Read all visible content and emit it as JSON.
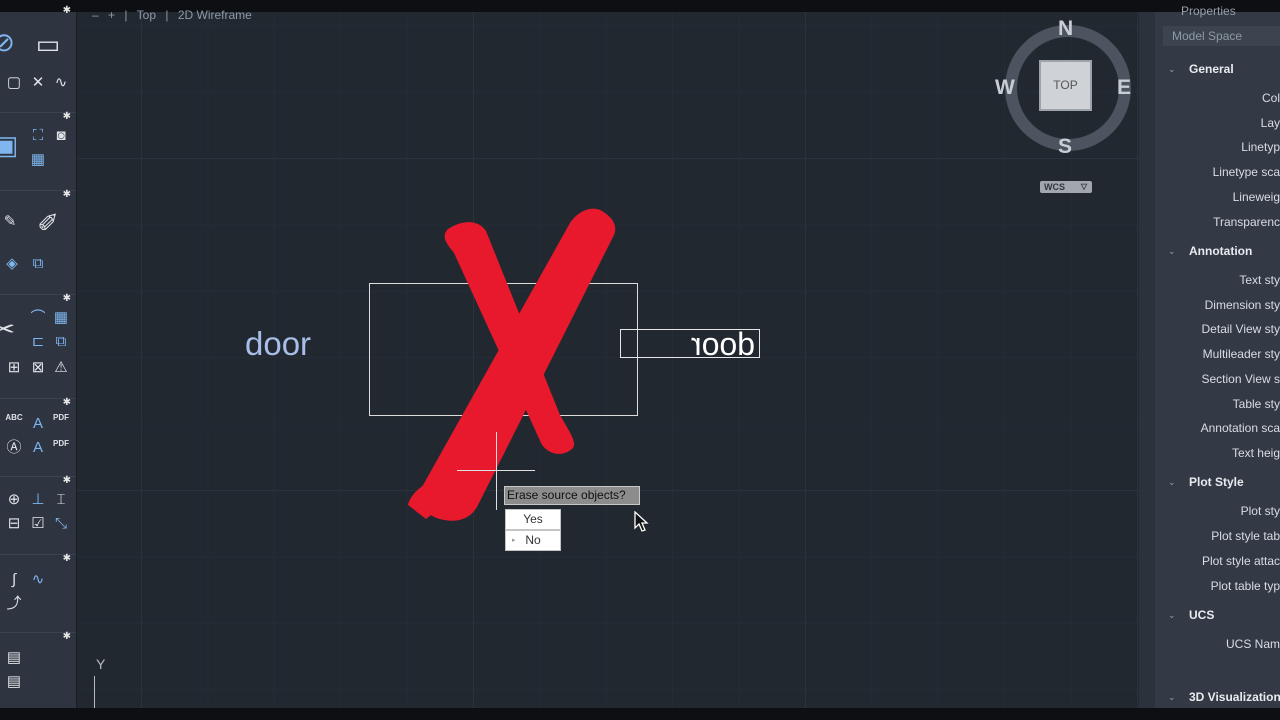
{
  "viewport": {
    "minus": "–",
    "plus": "+",
    "view": "Top",
    "visual_style": "2D Wireframe"
  },
  "drawing": {
    "label": "door",
    "mirror_label": "door"
  },
  "prompt": {
    "question": "Erase source objects?",
    "yes": "Yes",
    "no": "No"
  },
  "viewcube": {
    "n": "N",
    "s": "S",
    "e": "E",
    "w": "W",
    "face": "TOP",
    "wcs": "WCS"
  },
  "ucs": {
    "y": "Y"
  },
  "properties": {
    "title": "Properties",
    "selector": "Model Space",
    "general": {
      "title": "General",
      "items": [
        "Col",
        "Lay",
        "Linetyp",
        "Linetype sca",
        "Lineweig",
        "Transparenc"
      ]
    },
    "annotation": {
      "title": "Annotation",
      "items": [
        "Text sty",
        "Dimension sty",
        "Detail View sty",
        "Multileader sty",
        "Section View s",
        "Table sty",
        "Annotation sca",
        "Text heig"
      ]
    },
    "plot_style": {
      "title": "Plot Style",
      "items": [
        "Plot sty",
        "Plot style tab",
        "Plot style attac",
        "Plot table typ"
      ]
    },
    "ucs": {
      "title": "UCS",
      "items": [
        "UCS Nam"
      ]
    },
    "viz": {
      "title": "3D Visualization"
    }
  },
  "toolbar": {
    "abc": "ABC",
    "pdf": "PDF"
  },
  "colors": {
    "accent_red": "#e8192c",
    "canvas": "#212830",
    "panel": "#2e3440"
  }
}
